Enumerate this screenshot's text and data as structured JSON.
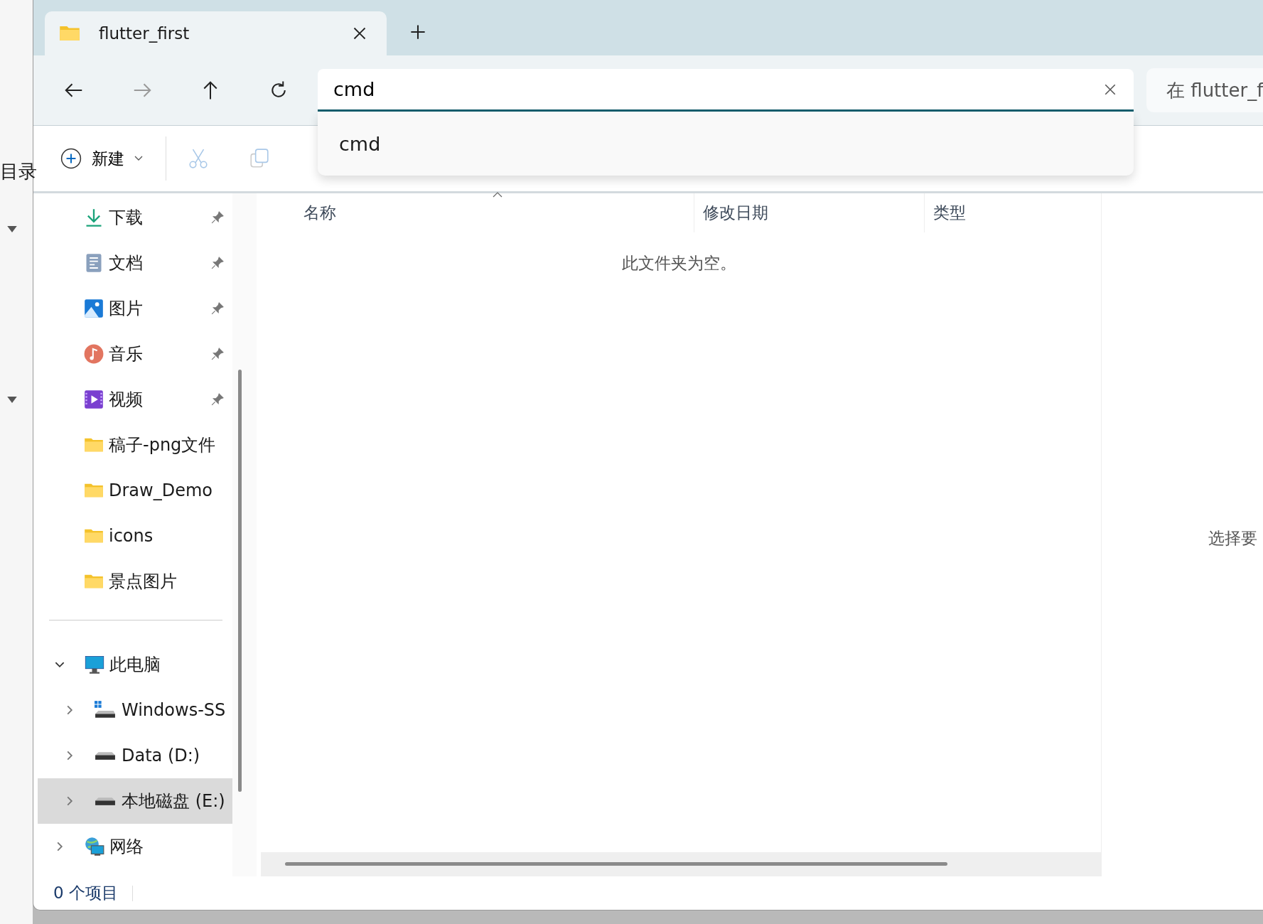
{
  "background_window": {
    "heading": "目录"
  },
  "tabs": [
    {
      "title": "flutter_first",
      "selected": true
    }
  ],
  "address_bar": {
    "value": "cmd"
  },
  "suggestions": [
    "cmd"
  ],
  "search": {
    "placeholder": "在 flutter_f"
  },
  "toolbar": {
    "new_label": "新建"
  },
  "sidebar": {
    "quick_access": [
      {
        "label": "下载",
        "kind": "download",
        "pinned": true
      },
      {
        "label": "文档",
        "kind": "document",
        "pinned": true
      },
      {
        "label": "图片",
        "kind": "picture",
        "pinned": true
      },
      {
        "label": "音乐",
        "kind": "music",
        "pinned": true
      },
      {
        "label": "视频",
        "kind": "video",
        "pinned": true
      },
      {
        "label": "稿子-png文件",
        "kind": "folder",
        "pinned": false
      },
      {
        "label": "Draw_Demo",
        "kind": "folder",
        "pinned": false
      },
      {
        "label": "icons",
        "kind": "folder",
        "pinned": false
      },
      {
        "label": "景点图片",
        "kind": "folder",
        "pinned": false
      }
    ],
    "this_pc": {
      "label": "此电脑",
      "expanded": true,
      "children": [
        {
          "label": "Windows-SS",
          "kind": "system-drive",
          "expanded": false,
          "selected": false
        },
        {
          "label": "Data (D:)",
          "kind": "drive",
          "expanded": false,
          "selected": false
        },
        {
          "label": "本地磁盘 (E:)",
          "kind": "drive",
          "expanded": false,
          "selected": true
        }
      ]
    },
    "network": {
      "label": "网络",
      "expanded": false
    }
  },
  "table": {
    "columns": [
      {
        "label": "名称",
        "sorted": true
      },
      {
        "label": "修改日期",
        "sorted": false
      },
      {
        "label": "类型",
        "sorted": false
      }
    ],
    "empty_message": "此文件夹为空。"
  },
  "details_pane": {
    "message": "选择要"
  },
  "status_bar": {
    "item_count": "0 个项目"
  }
}
